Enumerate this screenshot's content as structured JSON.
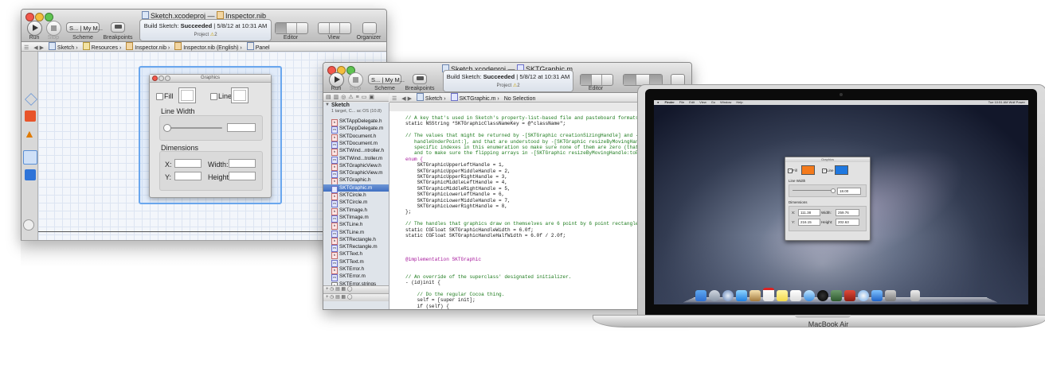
{
  "window1": {
    "title": "Sketch.xcodeproj — ",
    "title_file": "Inspector.nib",
    "toolbar": {
      "run": "Run",
      "stop": "Stop",
      "scheme": "Scheme",
      "breakpoints": "Breakpoints",
      "scheme_target": "S...",
      "scheme_dest": "My M...",
      "editor": "Editor",
      "view": "View",
      "organizer": "Organizer"
    },
    "activity": {
      "status": "Build Sketch:",
      "result": "Succeeded",
      "time": "5/8/12 at 10:31 AM",
      "project": "Project",
      "warnings": "2"
    },
    "jumpbar": [
      "Sketch",
      "Resources",
      "Inspector.nib",
      "Inspector.nib (English)",
      "Panel"
    ],
    "panel": {
      "title": "Graphics",
      "fill": "Fill",
      "line": "Line",
      "line_width": "Line Width",
      "dimensions": "Dimensions",
      "x": "X:",
      "y": "Y:",
      "width": "Width:",
      "height": "Height:"
    }
  },
  "window2": {
    "title": "Sketch.xcodeproj — ",
    "title_file": "SKTGraphic.m",
    "toolbar": {
      "run": "Run",
      "stop": "Stop",
      "scheme": "Scheme",
      "breakpoints": "Breakpoints",
      "scheme_target": "S...",
      "scheme_dest": "My M...",
      "editor": "Editor",
      "view": "Vi"
    },
    "activity": {
      "status": "Build Sketch:",
      "result": "Succeeded",
      "time": "5/8/12 at 10:31 AM",
      "project": "Project",
      "warnings": "2"
    },
    "jumpbar": [
      "Sketch",
      "SKTGraphic.m",
      "No Selection"
    ],
    "project": {
      "name": "Sketch",
      "subtitle": "1 target, C... ac OS (10.8)"
    },
    "files": [
      {
        "name": "SKTAppDelegate.h",
        "type": "h"
      },
      {
        "name": "SKTAppDelegate.m",
        "type": "m"
      },
      {
        "name": "SKTDocument.h",
        "type": "h"
      },
      {
        "name": "SKTDocument.m",
        "type": "m"
      },
      {
        "name": "SKTWind...ntroller.h",
        "type": "h"
      },
      {
        "name": "SKTWind...troller.m",
        "type": "m"
      },
      {
        "name": "SKTGraphicView.h",
        "type": "h"
      },
      {
        "name": "SKTGraphicView.m",
        "type": "m"
      },
      {
        "name": "SKTGraphic.h",
        "type": "h"
      },
      {
        "name": "SKTGraphic.m",
        "type": "m",
        "selected": true
      },
      {
        "name": "SKTCircle.h",
        "type": "h"
      },
      {
        "name": "SKTCircle.m",
        "type": "m"
      },
      {
        "name": "SKTImage.h",
        "type": "h"
      },
      {
        "name": "SKTImage.m",
        "type": "m"
      },
      {
        "name": "SKTLine.h",
        "type": "h"
      },
      {
        "name": "SKTLine.m",
        "type": "m"
      },
      {
        "name": "SKTRectangle.h",
        "type": "h"
      },
      {
        "name": "SKTRectangle.m",
        "type": "m"
      },
      {
        "name": "SKTText.h",
        "type": "h"
      },
      {
        "name": "SKTText.m",
        "type": "m"
      },
      {
        "name": "SKTError.h",
        "type": "h"
      },
      {
        "name": "SKTError.m",
        "type": "m"
      },
      {
        "name": "SKTError.strings",
        "type": "s"
      }
    ],
    "code": [
      {
        "t": "// A key that's used in Sketch's property-list-based file and pasteboard formats.",
        "c": "cm"
      },
      {
        "t": "static NSString *SKTGraphicClassNameKey = @\"className\";",
        "c": ""
      },
      {
        "t": "",
        "c": ""
      },
      {
        "t": "// The values that might be returned by -[SKTGraphic creationSizingHandle] and -[SKTGrap",
        "c": "cm"
      },
      {
        "t": "   handleUnderPoint:], and that are understood by -[SKTGraphic resizeByMovingHandle:to",
        "c": "cm"
      },
      {
        "t": "   specific indexes in this enumeration so make sure none of them are zero (that's SKTG",
        "c": "cm"
      },
      {
        "t": "   and to make sure the flipping arrays in -[SKTGraphic resizeByMovingHandle:toPoint:]",
        "c": "cm"
      },
      {
        "t": "enum {",
        "c": "kw"
      },
      {
        "t": "    SKTGraphicUpperLeftHandle = 1,",
        "c": ""
      },
      {
        "t": "    SKTGraphicUpperMiddleHandle = 2,",
        "c": ""
      },
      {
        "t": "    SKTGraphicUpperRightHandle = 3,",
        "c": ""
      },
      {
        "t": "    SKTGraphicMiddleLeftHandle = 4,",
        "c": ""
      },
      {
        "t": "    SKTGraphicMiddleRightHandle = 5,",
        "c": ""
      },
      {
        "t": "    SKTGraphicLowerLeftHandle = 6,",
        "c": ""
      },
      {
        "t": "    SKTGraphicLowerMiddleHandle = 7,",
        "c": ""
      },
      {
        "t": "    SKTGraphicLowerRightHandle = 8,",
        "c": ""
      },
      {
        "t": "};",
        "c": ""
      },
      {
        "t": "",
        "c": ""
      },
      {
        "t": "// The handles that graphics draw on themselves are 6 point by 6 point rectangles.",
        "c": "cm"
      },
      {
        "t": "static CGFloat SKTGraphicHandleWidth = 6.0f;",
        "c": ""
      },
      {
        "t": "static CGFloat SKTGraphicHandleHalfWidth = 6.0f / 2.0f;",
        "c": ""
      },
      {
        "t": "",
        "c": ""
      },
      {
        "t": "",
        "c": ""
      },
      {
        "t": "",
        "c": ""
      },
      {
        "t": "@implementation SKTGraphic",
        "c": "kw"
      },
      {
        "t": "",
        "c": ""
      },
      {
        "t": "",
        "c": ""
      },
      {
        "t": "// An override of the superclass' designated initializer.",
        "c": "cm"
      },
      {
        "t": "- (id)init {",
        "c": ""
      },
      {
        "t": "",
        "c": ""
      },
      {
        "t": "    // Do the regular Cocoa thing.",
        "c": "cm"
      },
      {
        "t": "    self = [super init];",
        "c": ""
      },
      {
        "t": "    if (self) {",
        "c": ""
      },
      {
        "t": "",
        "c": ""
      },
      {
        "t": "",
        "c": ""
      },
      {
        "t": "    Tl [\"\"ll",
        "c": "ghost"
      },
      {
        "t": "    S[L = [ENdEL InIL]",
        "c": "ghost"
      }
    ]
  },
  "macbook": {
    "label": "MacBook Air",
    "menubar": {
      "apple": "",
      "items": [
        "Finder",
        "File",
        "Edit",
        "View",
        "Go",
        "Window",
        "Help"
      ],
      "clock": "Tue 10:51 AM",
      "user": "Wolf Power"
    },
    "panel": {
      "title": "Graphics",
      "fill": "Fill",
      "line": "Line",
      "line_width": "Line Width",
      "line_width_value": "18.00",
      "dimensions": "Dimensions",
      "x": "X:",
      "x_value": "111.38",
      "y": "Y:",
      "y_value": "216.15",
      "width": "Width:",
      "width_value": "259.76",
      "height": "Height:",
      "height_value": "202.63"
    },
    "colors": {
      "fill": "#f47a1c",
      "line": "#1f78e0"
    }
  }
}
